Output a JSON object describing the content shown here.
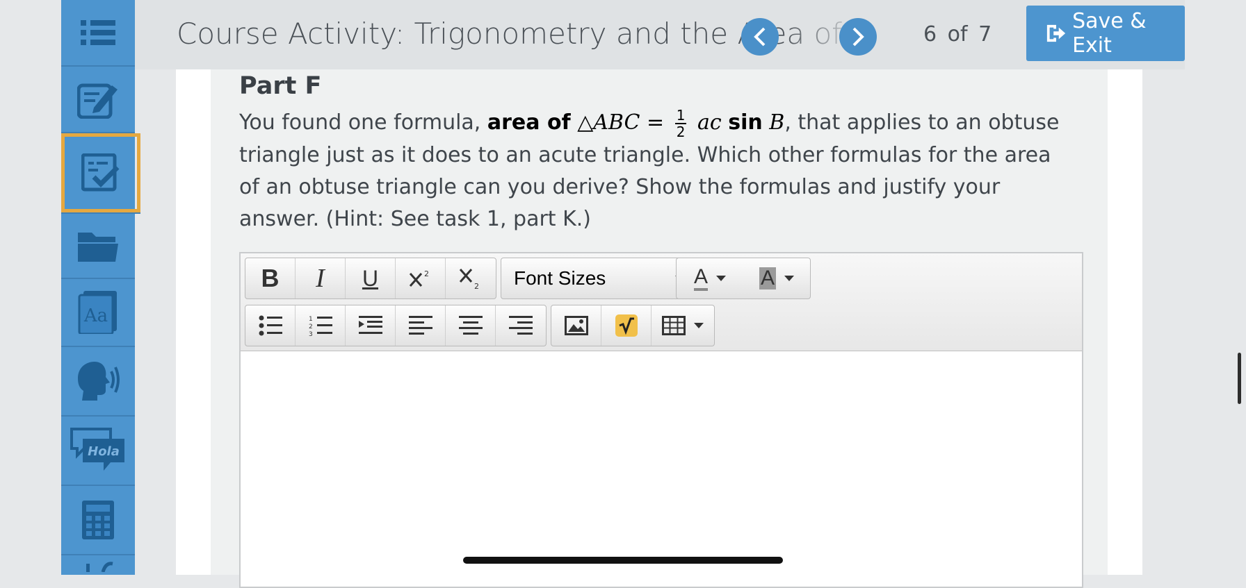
{
  "header": {
    "course_title": "Course Activity: Trigonometry and the Area of Obtuse Triangles",
    "page_current": "6",
    "page_of": "of",
    "page_total": "7",
    "save_exit_label": "Save & Exit",
    "prev_icon": "chevron-left-icon",
    "next_icon": "chevron-right-icon"
  },
  "sidebar": {
    "items": [
      {
        "icon": "menu-list-icon"
      },
      {
        "icon": "notes-edit-icon"
      },
      {
        "icon": "task-check-icon",
        "active": true
      },
      {
        "icon": "folder-icon"
      },
      {
        "icon": "dictionary-icon",
        "text": "Aa"
      },
      {
        "icon": "text-to-speech-icon"
      },
      {
        "icon": "translate-icon",
        "text": "Hola"
      },
      {
        "icon": "calculator-icon"
      }
    ]
  },
  "content": {
    "part_title": "Part F",
    "question_before": "You found one formula,",
    "formula_bold": "area of",
    "formula_tri": "△ABC =",
    "frac_num": "1",
    "frac_den": "2",
    "formula_tail": "ac",
    "formula_sin": "sin",
    "formula_B": "B",
    "question_after": ", that applies to an obtuse triangle just as it does to an acute triangle. Which other formulas for the area of an obtuse triangle can you derive? Show the formulas and justify your answer. (Hint: See task 1, part K.)"
  },
  "editor": {
    "font_sizes_label": "Font Sizes",
    "bold": "B",
    "italic": "I",
    "underline": "U",
    "text_color": "A",
    "bg_color": "A",
    "accent_color": "#4d95cf",
    "highlight_color": "#e5a840"
  }
}
